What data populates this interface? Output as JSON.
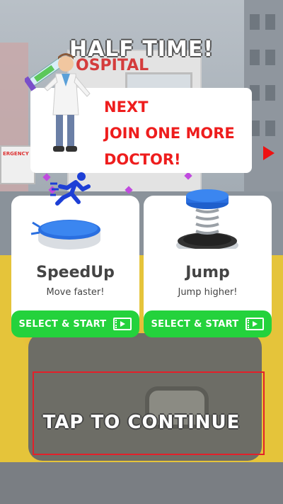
{
  "hud": {
    "title": "HALF TIME!"
  },
  "scene": {
    "hospital_sign": "OSPITAL",
    "ambulance_label": "ERGENCY"
  },
  "next_panel": {
    "line1": "NEXT",
    "line2": "JOIN ONE MORE",
    "line3": "DOCTOR!"
  },
  "cards": [
    {
      "title": "SpeedUp",
      "subtitle": "Move faster!",
      "button_label": "SELECT & START",
      "icon": "running-man-icon",
      "accent": "#1d3fd6"
    },
    {
      "title": "Jump",
      "subtitle": "Jump higher!",
      "button_label": "SELECT & START",
      "icon": "spring-pad-icon",
      "accent": "#2a6fe0"
    }
  ],
  "footer": {
    "tap_label": "TAP TO CONTINUE"
  },
  "colors": {
    "button_green": "#24d23c",
    "next_red": "#ee1d1d",
    "tap_border": "#e3202a"
  }
}
